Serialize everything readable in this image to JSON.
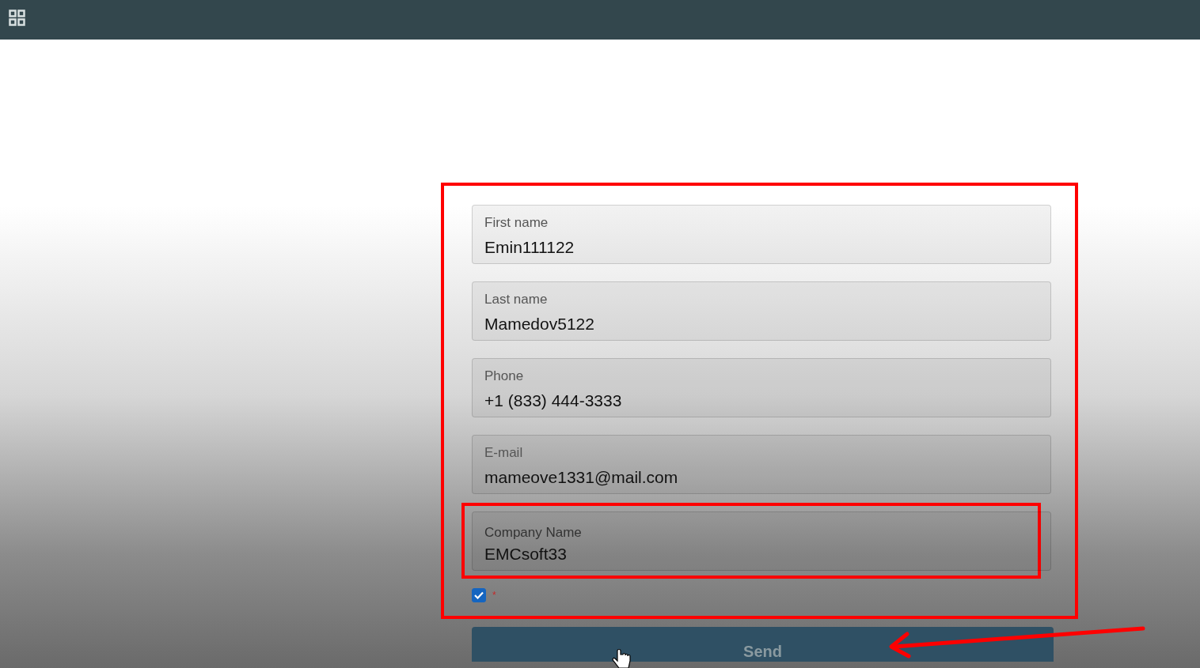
{
  "form": {
    "outlined": true,
    "fields": [
      {
        "label": "First name",
        "value": "Emin111122",
        "highlighted": false
      },
      {
        "label": "Last name",
        "value": "Mamedov5122",
        "highlighted": false
      },
      {
        "label": "Phone",
        "value": "+1 (833) 444-3333",
        "highlighted": false
      },
      {
        "label": "E-mail",
        "value": "mameove1331@mail.com",
        "highlighted": false
      },
      {
        "label": "Company Name",
        "value": "EMCsoft33",
        "highlighted": true
      }
    ],
    "consent": {
      "checked": true,
      "required_mark": "*"
    },
    "send_button": {
      "label": "Send",
      "disabled": true,
      "arrow": true
    }
  }
}
